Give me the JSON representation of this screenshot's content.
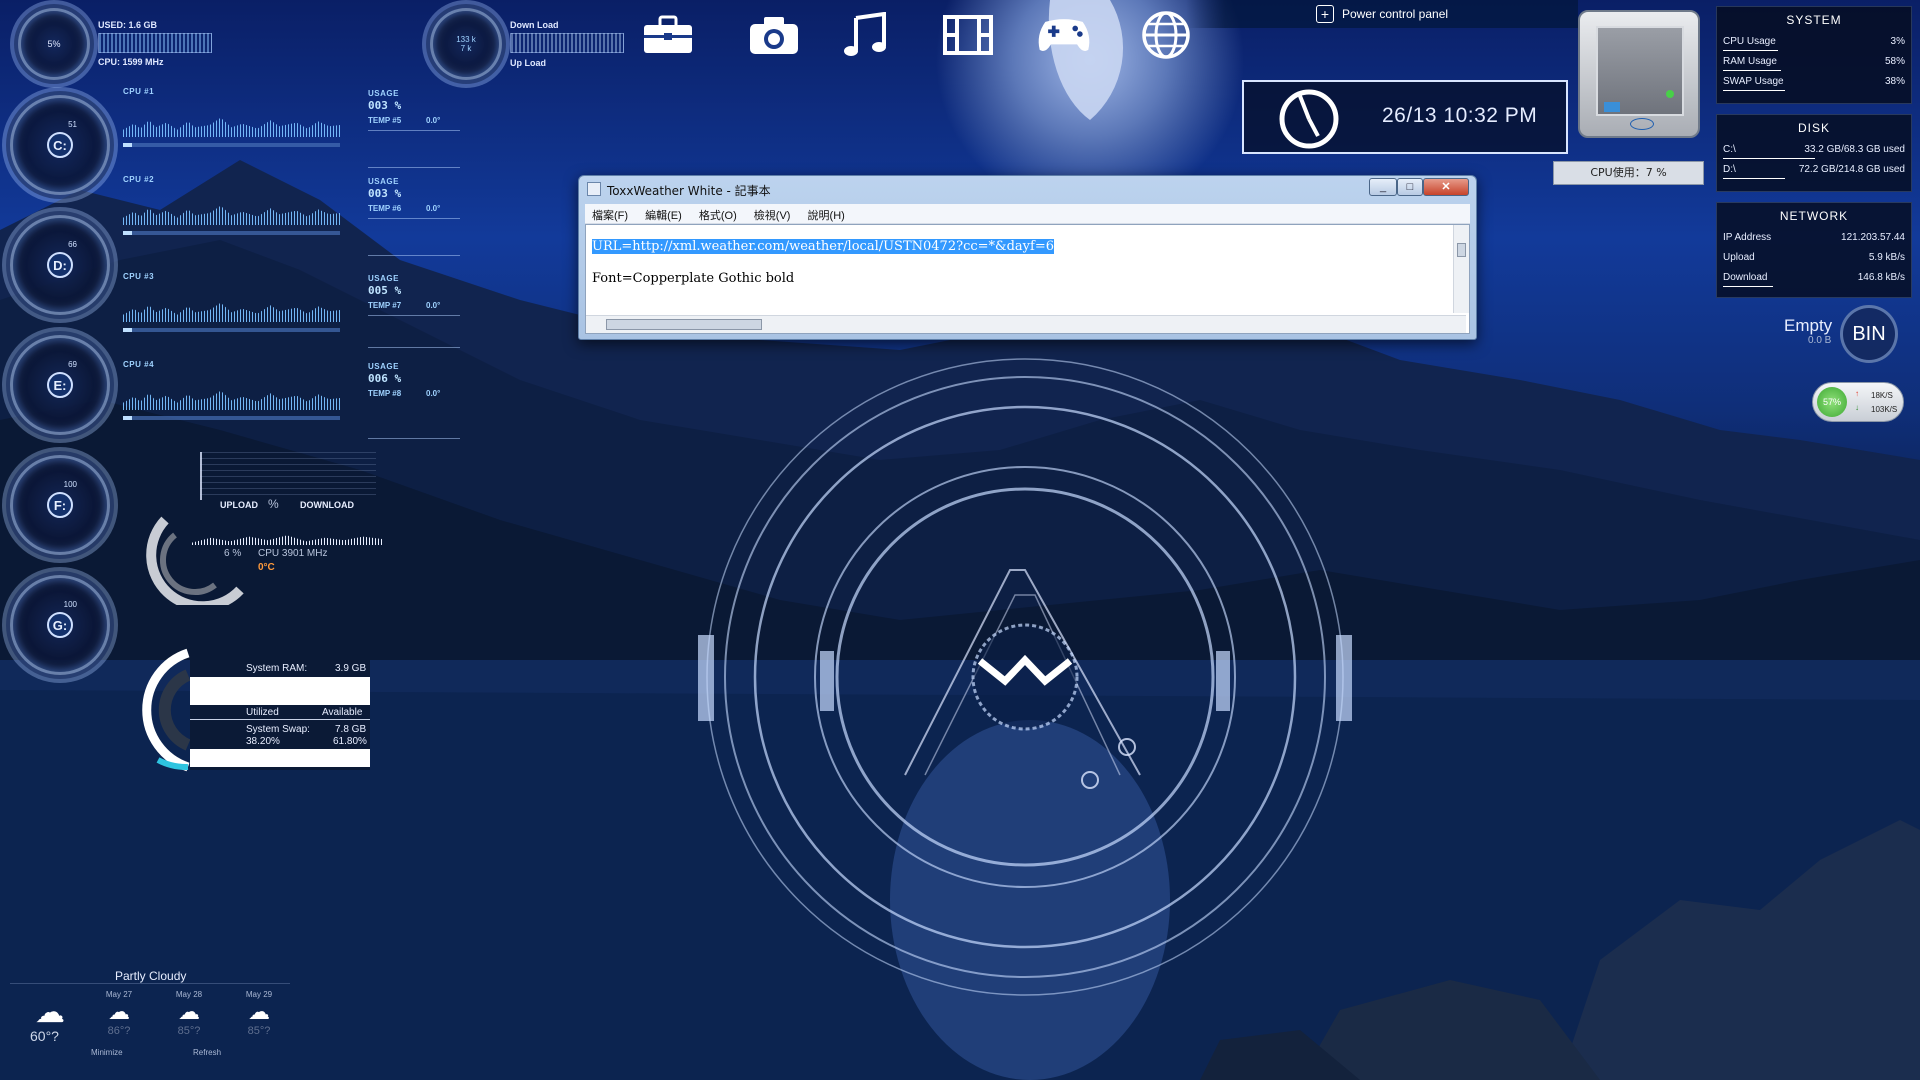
{
  "colors": {
    "accent": "#9fd2ff",
    "panel": "#050c1e",
    "selection": "#3399ff"
  },
  "top_left": {
    "cpu_gauge_pct": "5%",
    "used_label": "USED: 1.6 GB",
    "cpu_label": "CPU: 1599 MHz",
    "net_down": "133 k",
    "net_up": "7 k",
    "down_label": "Down Load",
    "up_label": "Up Load"
  },
  "drives": [
    {
      "letter": "C:",
      "pct": "51"
    },
    {
      "letter": "D:",
      "pct": "66"
    },
    {
      "letter": "E:",
      "pct": "69"
    },
    {
      "letter": "F:",
      "pct": "100"
    },
    {
      "letter": "G:",
      "pct": "100"
    }
  ],
  "cpus": [
    {
      "label": "CPU #1",
      "usage_label": "USAGE",
      "usage": "003 %",
      "temp_label": "TEMP #5",
      "temp": "0.0°"
    },
    {
      "label": "CPU #2",
      "usage_label": "USAGE",
      "usage": "003 %",
      "temp_label": "TEMP #6",
      "temp": "0.0°"
    },
    {
      "label": "CPU #3",
      "usage_label": "USAGE",
      "usage": "005 %",
      "temp_label": "TEMP #7",
      "temp": "0.0°"
    },
    {
      "label": "CPU #4",
      "usage_label": "USAGE",
      "usage": "006 %",
      "temp_label": "TEMP #8",
      "temp": "0.0°"
    }
  ],
  "net_widget": {
    "upload": "UPLOAD",
    "download": "DOWNLOAD",
    "percent": "%",
    "cpu_pct": "6 %",
    "cpu_mhz": "CPU 3901 MHz",
    "temp": "0°C"
  },
  "ram_widget": {
    "ram_label": "System RAM:",
    "ram_value": "3.9 GB",
    "utilized": "Utilized",
    "available": "Available",
    "swap_label": "System Swap:",
    "swap_value": "7.8 GB",
    "swap_used": "38.20%",
    "swap_free": "61.80%"
  },
  "weather": {
    "condition": "Partly Cloudy",
    "current_temp": "60°?",
    "days": [
      {
        "date": "May 27",
        "temp": "86°?"
      },
      {
        "date": "May 28",
        "temp": "85°?"
      },
      {
        "date": "May 29",
        "temp": "85°?"
      }
    ],
    "minimize": "Minimize",
    "refresh": "Refresh"
  },
  "top_icons": [
    "toolbox-icon",
    "camera-icon",
    "music-icon",
    "film-icon",
    "gamepad-icon",
    "globe-icon"
  ],
  "power_panel": {
    "label": "Power control panel"
  },
  "clock": {
    "text": "26/13  10:32 PM"
  },
  "cpu_meter": {
    "label": "CPU使用：7 %"
  },
  "system": {
    "title": "SYSTEM",
    "rows": [
      {
        "key": "CPU Usage",
        "value": "3%",
        "fill": 0.03
      },
      {
        "key": "RAM Usage",
        "value": "58%",
        "fill": 0.58
      },
      {
        "key": "SWAP Usage",
        "value": "38%",
        "fill": 0.38
      }
    ]
  },
  "disk": {
    "title": "DISK",
    "rows": [
      {
        "key": "C:\\",
        "value": "33.2 GB/68.3 GB used",
        "fill": 0.49
      },
      {
        "key": "D:\\",
        "value": "72.2 GB/214.8 GB used",
        "fill": 0.34
      }
    ]
  },
  "network": {
    "title": "NETWORK",
    "rows": [
      {
        "key": "IP Address",
        "value": "121.203.57.44"
      },
      {
        "key": "Upload",
        "value": "5.9 kB/s"
      },
      {
        "key": "Download",
        "value": "146.8 kB/s"
      }
    ]
  },
  "bin": {
    "status": "Empty",
    "size": "0.0 B",
    "label": "BIN"
  },
  "net_meter": {
    "pct": "57%",
    "up": "18K/S",
    "down": "103K/S"
  },
  "notepad": {
    "title": "ToxxWeather White - 記事本",
    "menus": [
      "檔案(F)",
      "編輯(E)",
      "格式(O)",
      "檢視(V)",
      "說明(H)"
    ],
    "line1": "URL=http://xml.weather.com/weather/local/USTN0472?cc=*&dayf=6",
    "line2": "Font=Copperplate Gothic bold"
  }
}
